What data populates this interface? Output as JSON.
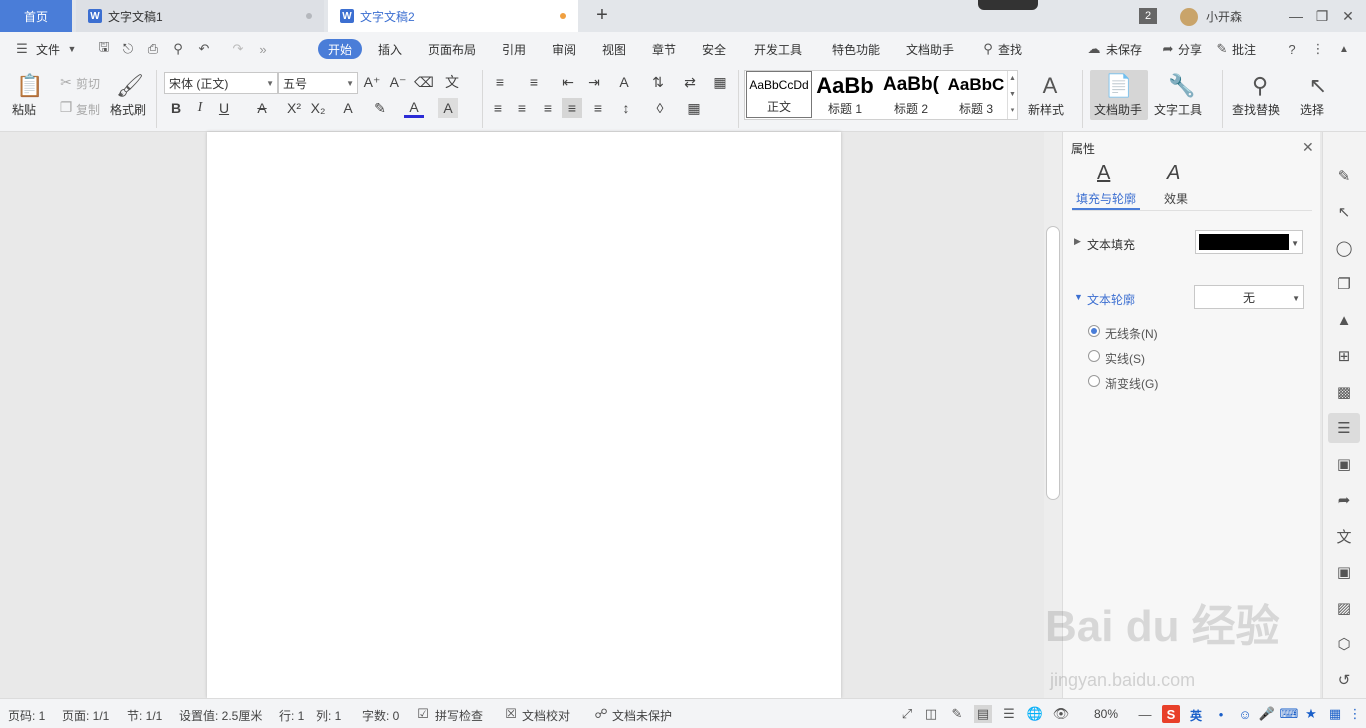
{
  "titlebar": {
    "home_tab": "首页",
    "tabs": [
      {
        "label": "文字文稿1"
      },
      {
        "label": "文字文稿2"
      }
    ],
    "doc_icon": "W",
    "new_tab": "+",
    "window_count": "2",
    "user": "小开森"
  },
  "menubar": {
    "file": "文件",
    "items": [
      "开始",
      "插入",
      "页面布局",
      "引用",
      "审阅",
      "视图",
      "章节",
      "安全",
      "开发工具",
      "特色功能",
      "文档助手"
    ],
    "search": "查找",
    "unsaved": "未保存",
    "share": "分享",
    "comment": "批注"
  },
  "ribbon": {
    "paste": "粘贴",
    "cut": "剪切",
    "copy": "复制",
    "format_painter": "格式刷",
    "font_name": "宋体 (正文)",
    "font_size": "五号",
    "styles": [
      {
        "preview": "AaBbCcDd",
        "label": "正文"
      },
      {
        "preview": "AaBb",
        "label": "标题 1"
      },
      {
        "preview": "AaBb(",
        "label": "标题 2"
      },
      {
        "preview": "AaBbC",
        "label": "标题 3"
      }
    ],
    "new_style": "新样式",
    "doc_assistant": "文档助手",
    "text_tools": "文字工具",
    "find_replace": "查找替换",
    "select": "选择",
    "font_color": "#2b2bd6"
  },
  "panel": {
    "title": "属性",
    "tabs": [
      {
        "label": "填充与轮廓"
      },
      {
        "label": "效果"
      }
    ],
    "text_fill": "文本填充",
    "fill_color": "#000000",
    "text_outline": "文本轮廓",
    "outline_value": "无",
    "options": [
      {
        "label": "无线条(N)",
        "selected": true
      },
      {
        "label": "实线(S)",
        "selected": false
      },
      {
        "label": "渐变线(G)",
        "selected": false
      }
    ]
  },
  "statusbar": {
    "page_num": "页码: 1",
    "pages": "页面: 1/1",
    "section": "节: 1/1",
    "setting": "设置值: 2.5厘米",
    "row": "行: 1",
    "col": "列: 1",
    "words": "字数: 0",
    "spell": "拼写检查",
    "proof": "文档校对",
    "protect": "文档未保护",
    "zoom": "80%",
    "ime": "英"
  },
  "watermark": {
    "text": "Bai du 经验",
    "url": "jingyan.baidu.com"
  }
}
